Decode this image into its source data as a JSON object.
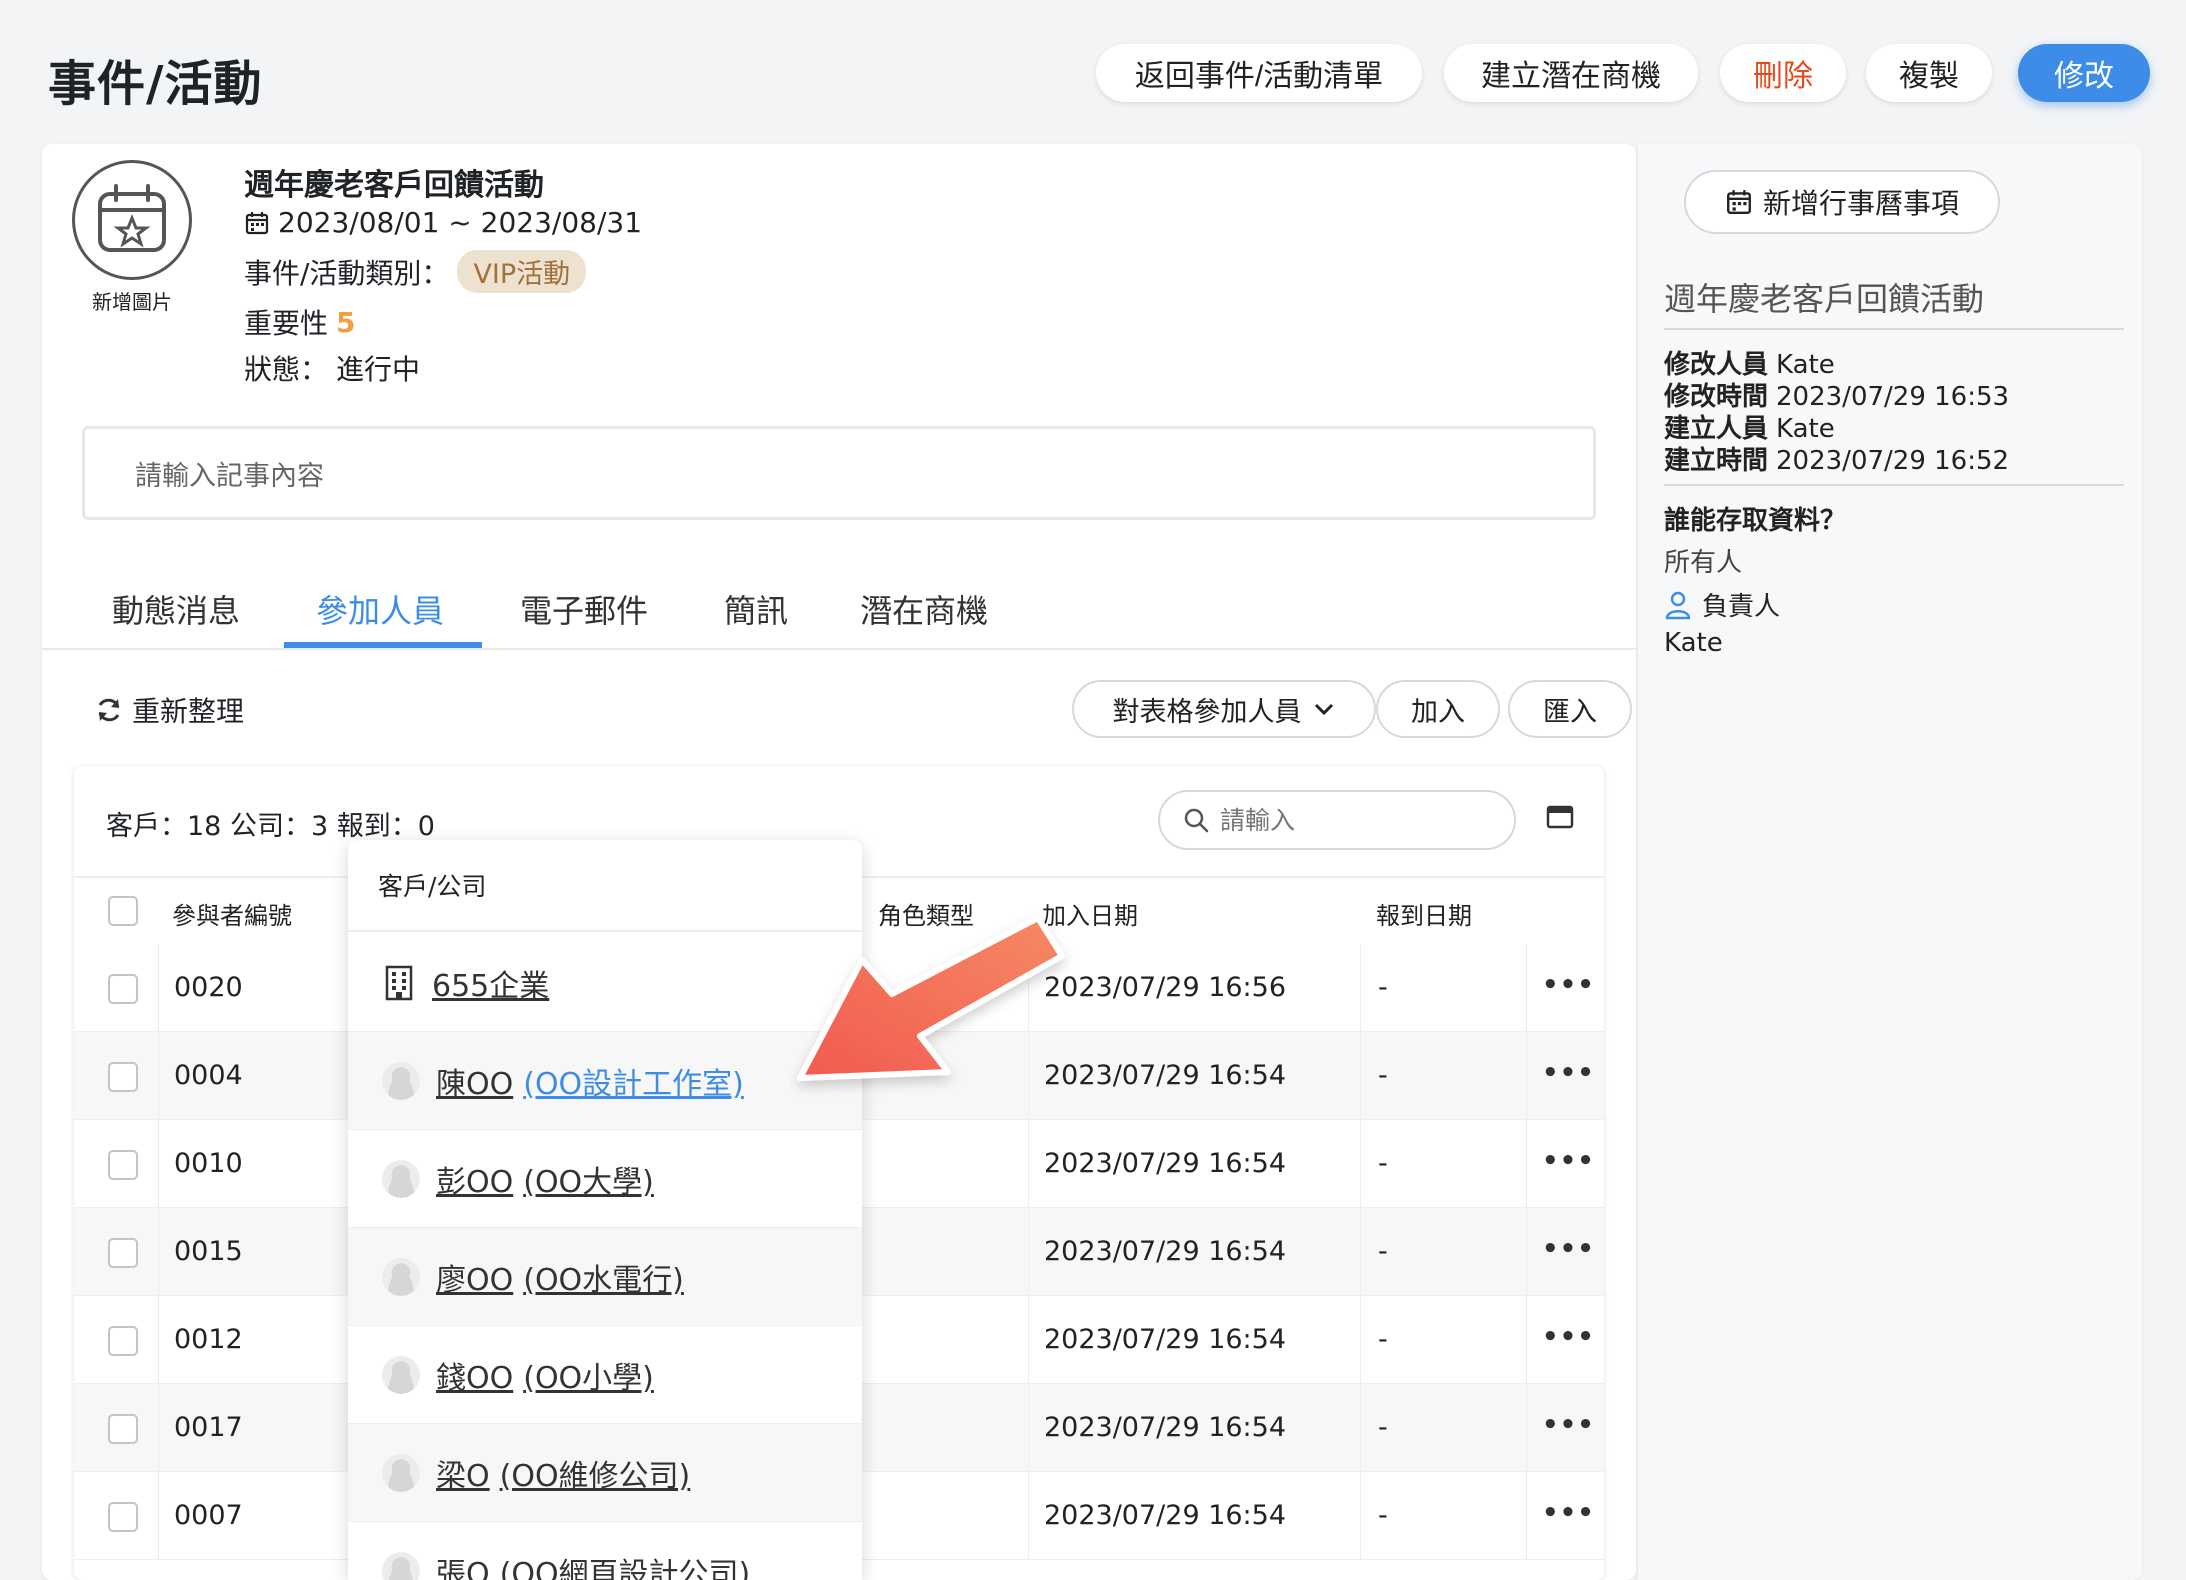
{
  "header": {
    "title": "事件/活動",
    "buttons": {
      "back": "返回事件/活動清單",
      "create_opportunity": "建立潛在商機",
      "delete": "刪除",
      "copy": "複製",
      "edit": "修改"
    }
  },
  "event": {
    "add_image_label": "新增圖片",
    "name": "週年慶老客戶回饋活動",
    "date_range": "2023/08/01 ~ 2023/08/31",
    "category_label": "事件/活動類別：",
    "category": "VIP活動",
    "importance_label": "重要性",
    "importance": "5",
    "status_label": "狀態：",
    "status": "進行中",
    "note_placeholder": "請輸入記事內容"
  },
  "tabs": [
    "動態消息",
    "參加人員",
    "電子郵件",
    "簡訊",
    "潛在商機"
  ],
  "toolbar": {
    "refresh": "重新整理",
    "table_action": "對表格參加人員",
    "join": "加入",
    "import": "匯入"
  },
  "table": {
    "summary": "客戶：18 公司：3 報到：0",
    "search_placeholder": "請輸入",
    "headers": {
      "id": "參與者編號",
      "role": "角色類型",
      "join_date": "加入日期",
      "checkin_date": "報到日期"
    },
    "rows": [
      {
        "id": "0020",
        "join_date": "2023/07/29 16:56",
        "checkin": "-"
      },
      {
        "id": "0004",
        "join_date": "2023/07/29 16:54",
        "checkin": "-"
      },
      {
        "id": "0010",
        "join_date": "2023/07/29 16:54",
        "checkin": "-"
      },
      {
        "id": "0015",
        "join_date": "2023/07/29 16:54",
        "checkin": "-"
      },
      {
        "id": "0012",
        "join_date": "2023/07/29 16:54",
        "checkin": "-"
      },
      {
        "id": "0017",
        "join_date": "2023/07/29 16:54",
        "checkin": "-"
      },
      {
        "id": "0007",
        "join_date": "2023/07/29 16:54",
        "checkin": "-"
      }
    ],
    "more_glyph": "•••"
  },
  "dropdown": {
    "header": "客戶/公司",
    "items": [
      {
        "name": "655企業",
        "company": ""
      },
      {
        "name": "陳OO",
        "company": "(OO設計工作室)"
      },
      {
        "name": "彭OO",
        "company": "(OO大學)"
      },
      {
        "name": "廖OO",
        "company": "(OO水電行)"
      },
      {
        "name": "錢OO",
        "company": "(OO小學)"
      },
      {
        "name": "梁O",
        "company": "(OO維修公司)"
      },
      {
        "name": "張O",
        "company": "(OO網頁設計公司)"
      }
    ]
  },
  "sidebar": {
    "add_calendar": "新增行事曆事項",
    "title": "週年慶老客戶回饋活動",
    "modified_by_label": "修改人員",
    "modified_by": "Kate",
    "modified_time_label": "修改時間",
    "modified_time": "2023/07/29 16:53",
    "created_by_label": "建立人員",
    "created_by": "Kate",
    "created_time_label": "建立時間",
    "created_time": "2023/07/29 16:52",
    "access_label": "誰能存取資料？",
    "access_all": "所有人",
    "owner_label": "負責人",
    "owner": "Kate"
  },
  "colors": {
    "accent": "#3d8de8",
    "delete": "#e64a19",
    "importance": "#f0a040",
    "arrow": "#f26b5b"
  }
}
